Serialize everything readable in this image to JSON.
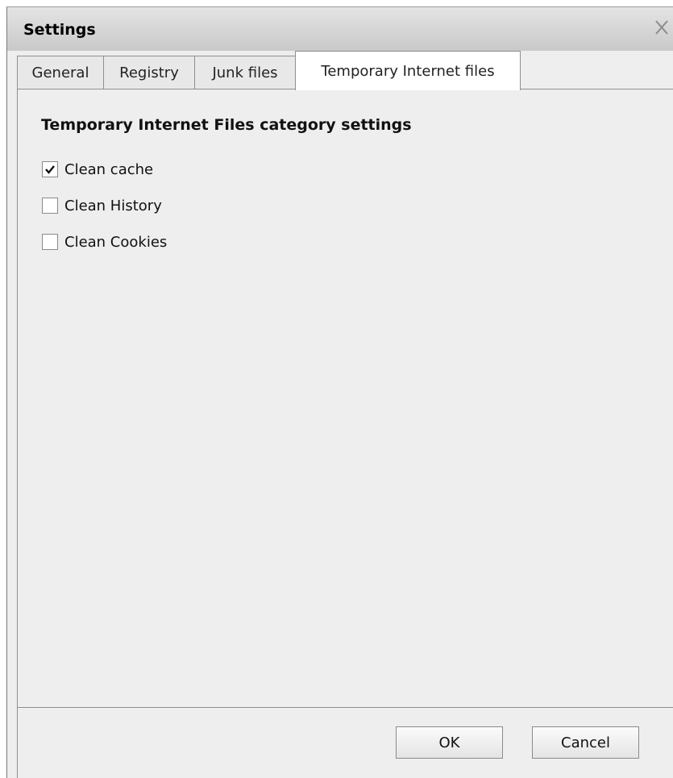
{
  "window": {
    "title": "Settings"
  },
  "tabs": [
    {
      "label": "General",
      "active": false
    },
    {
      "label": "Registry",
      "active": false
    },
    {
      "label": "Junk files",
      "active": false
    },
    {
      "label": "Temporary Internet files",
      "active": true
    }
  ],
  "panel": {
    "heading": "Temporary Internet Files category settings",
    "options": [
      {
        "label": "Clean cache",
        "checked": true
      },
      {
        "label": "Clean History",
        "checked": false
      },
      {
        "label": "Clean Cookies",
        "checked": false
      }
    ]
  },
  "footer": {
    "ok_label": "OK",
    "cancel_label": "Cancel"
  },
  "icons": {
    "close": "close-icon",
    "check": "checkmark-icon"
  }
}
